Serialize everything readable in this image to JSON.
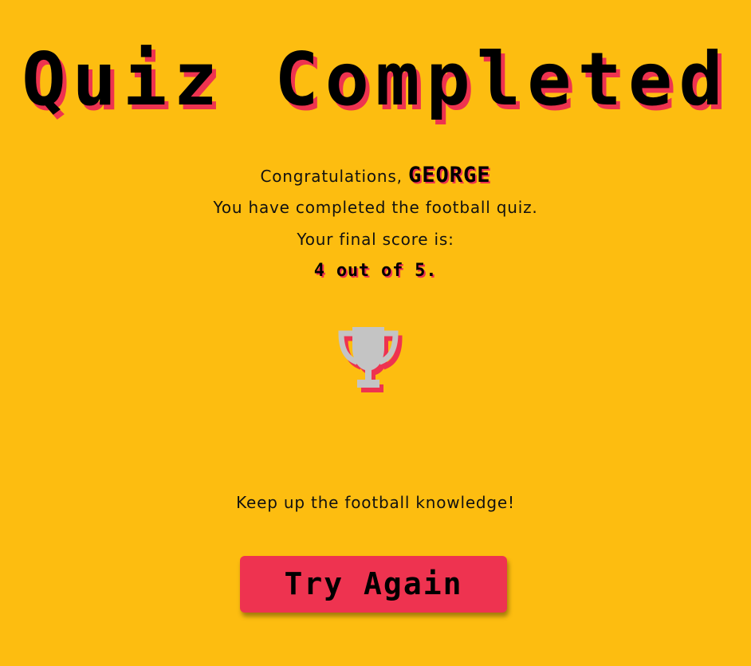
{
  "title": "Quiz Completed",
  "result": {
    "congrats_prefix": "Congratulations, ",
    "player_name": "GEORGE",
    "completed_text": "You have completed the football quiz.",
    "score_label": "Your final score is:",
    "score_text": "4 out of 5.",
    "trophy_icon": "trophy-icon"
  },
  "score": {
    "correct": 4,
    "total": 5
  },
  "footer_message": "Keep up the football knowledge!",
  "actions": {
    "try_again_label": "Try Again"
  },
  "colors": {
    "background": "#fdbd10",
    "accent": "#ee3350",
    "trophy": "#c4c4c4",
    "text": "#111111"
  }
}
